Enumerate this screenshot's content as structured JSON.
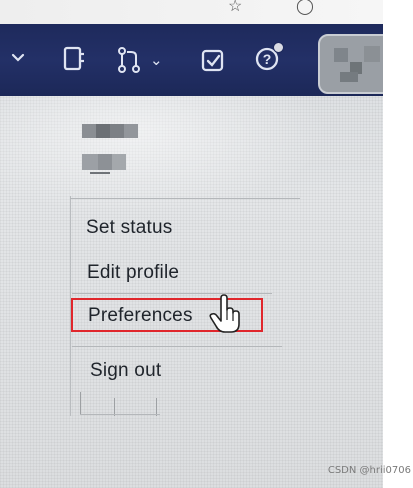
{
  "colors": {
    "navbar": "#1e2a5c",
    "highlight_border": "#e0262c",
    "menu_text": "#1f242b"
  },
  "navbar": {
    "items": [
      {
        "icon": "chevron-down-icon"
      },
      {
        "icon": "notebook-icon"
      },
      {
        "icon": "merge-request-icon"
      },
      {
        "icon": "todo-checkbox-icon"
      },
      {
        "icon": "help-icon"
      }
    ],
    "chevron": "⌄",
    "help_glyph": "?"
  },
  "user_menu": {
    "items": [
      {
        "label": "Set status"
      },
      {
        "label": "Edit profile"
      },
      {
        "label": "Preferences",
        "highlighted": true
      },
      {
        "label": "Sign out"
      }
    ]
  },
  "watermark": "CSDN @hrii0706"
}
